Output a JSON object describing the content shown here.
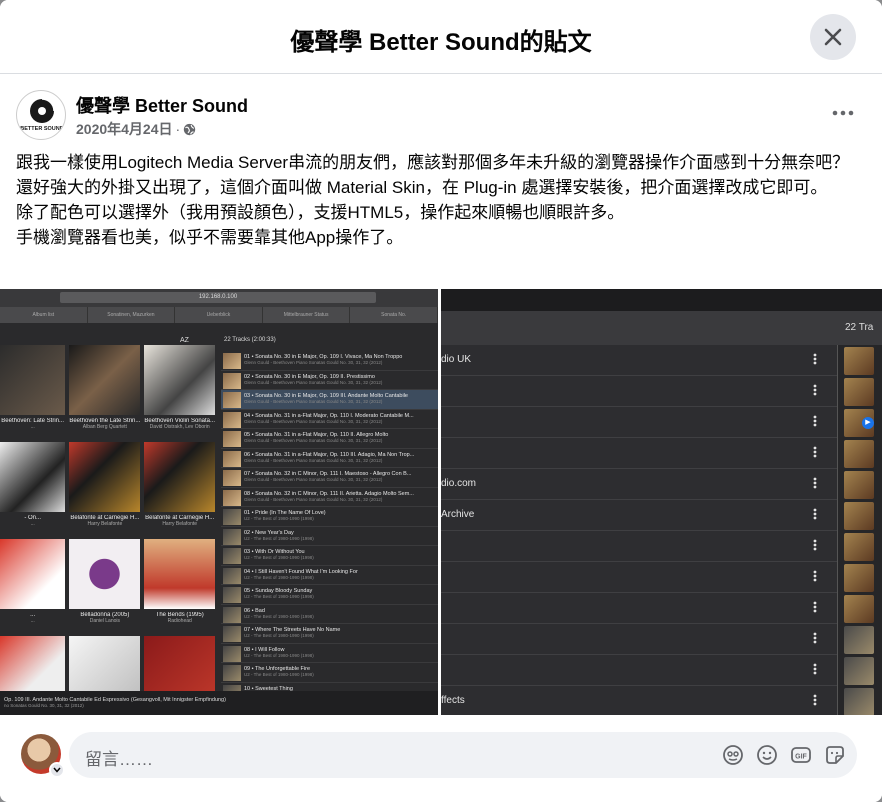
{
  "dialog": {
    "title": "優聲學 Better Sound的貼文",
    "close_label": "×"
  },
  "post": {
    "page_name": "優聲學 Better Sound",
    "logo_text": "BETTER SOUND",
    "date": "2020年4月24日",
    "date_separator": "·",
    "audience_icon": "globe-icon",
    "more_icon": "more-horizontal-icon",
    "paragraphs": [
      "跟我一樣使用Logitech Media Server串流的朋友們，應該對那個多年未升級的瀏覽器操作介面感到十分無奈吧？還好強大的外掛又出現了，這個介面叫做 Material Skin，在 Plug-in 處選擇安裝後，把介面選擇改成它即可。",
      "除了配色可以選擇外（我用預設顏色），支援HTML5，操作起來順暢也順眼許多。",
      "手機瀏覽器看也美，似乎不需要靠其他App操作了。"
    ]
  },
  "photo_left": {
    "url_text": "192.168.0.100",
    "tabs": [
      "Album list",
      "Sonatinen, Mazurken",
      "Ueberblick",
      "Mittelbrauner Status",
      "Sonata No."
    ],
    "toolbar": "AZ",
    "tracks_header": "22 Tracks (2:00:33)",
    "albums": [
      {
        "title": "Beethoven: Late Strin...",
        "sub": "..."
      },
      {
        "title": "Beethoven the Late Strin...",
        "sub": "Alban Berg Quartett"
      },
      {
        "title": "Beethoven Violin Sonata...",
        "sub": "David Oistrakh, Lev Oborin"
      },
      {
        "title": "- On...",
        "sub": "..."
      },
      {
        "title": "Belafonte at Carnegie H...",
        "sub": "Harry Belafonte"
      },
      {
        "title": "Belafonte at Carnegie H...",
        "sub": "Harry Belafonte"
      },
      {
        "title": "...",
        "sub": "..."
      },
      {
        "title": "Belladonna (2005)",
        "sub": "Daniel Lanois"
      },
      {
        "title": "The Bends (1995)",
        "sub": "Radiohead"
      },
      {
        "title": "...",
        "sub": ""
      },
      {
        "title": "",
        "sub": ""
      },
      {
        "title": "",
        "sub": ""
      }
    ],
    "tracks": [
      {
        "title": "01 • Sonata No. 30 in E Major, Op. 109 I. Vivace, Ma Non Troppo",
        "sub": "Glenn Gould - Beethoven Piano Sonatas Gould No. 30, 31, 32 (2012)"
      },
      {
        "title": "02 • Sonata No. 30 in E Major, Op. 109 II. Prestissimo",
        "sub": "Glenn Gould - Beethoven Piano Sonatas Gould No. 30, 31, 32 (2012)"
      },
      {
        "title": "03 • Sonata No. 30 in E Major, Op. 109 III. Andante Molto Cantabile",
        "sub": "Glenn Gould - Beethoven Piano Sonatas Gould No. 30, 31, 32 (2012)"
      },
      {
        "title": "04 • Sonata No. 31 in a-Flat Major, Op. 110 I. Moderato Cantabile M...",
        "sub": "Glenn Gould - Beethoven Piano Sonatas Gould No. 30, 31, 32 (2012)"
      },
      {
        "title": "05 • Sonata No. 31 in a-Flat Major, Op. 110 II. Allegro Molto",
        "sub": "Glenn Gould - Beethoven Piano Sonatas Gould No. 30, 31, 32 (2012)"
      },
      {
        "title": "06 • Sonata No. 31 in a-Flat Major, Op. 110 III. Adagio, Ma Non Trop...",
        "sub": "Glenn Gould - Beethoven Piano Sonatas Gould No. 30, 31, 32 (2012)"
      },
      {
        "title": "07 • Sonata No. 32 in C Minor, Op. 111 I. Maestoso - Allegro Con B...",
        "sub": "Glenn Gould - Beethoven Piano Sonatas Gould No. 30, 31, 32 (2012)"
      },
      {
        "title": "08 • Sonata No. 32 in C Minor, Op. 111 II. Arietta. Adagio Molto Sem...",
        "sub": "Glenn Gould - Beethoven Piano Sonatas Gould No. 30, 31, 32 (2012)"
      },
      {
        "title": "01 • Pride (In The Name Of Love)",
        "sub": "U2 - The Best of 1980-1990 (1998)"
      },
      {
        "title": "02 • New Year's Day",
        "sub": "U2 - The Best of 1980-1990 (1998)"
      },
      {
        "title": "03 • With Or Without You",
        "sub": "U2 - The Best of 1980-1990 (1998)"
      },
      {
        "title": "04 • I Still Haven't Found What I'm Looking For",
        "sub": "U2 - The Best of 1980-1990 (1998)"
      },
      {
        "title": "05 • Sunday Bloody Sunday",
        "sub": "U2 - The Best of 1980-1990 (1998)"
      },
      {
        "title": "06 • Bad",
        "sub": "U2 - The Best of 1980-1990 (1998)"
      },
      {
        "title": "07 • Where The Streets Have No Name",
        "sub": "U2 - The Best of 1980-1990 (1998)"
      },
      {
        "title": "08 • I Will Follow",
        "sub": "U2 - The Best of 1980-1990 (1998)"
      },
      {
        "title": "09 • The Unforgettable Fire",
        "sub": "U2 - The Best of 1980-1990 (1998)"
      },
      {
        "title": "10 • Sweetest Thing",
        "sub": "U2 - The Best of 1980-1990 (1998)"
      }
    ],
    "now_playing": "Op. 109 III. Andante Molto Cantabile Ed Espressivo (Gesangvoll, Mit Innigster Empfindung)",
    "now_playing_sub": "no Sonatas Gould No. 30, 31, 32 (2012)"
  },
  "photo_right": {
    "tracks_label": "22 Tra",
    "rows": [
      "dio UK",
      "",
      "",
      "",
      "dio.com",
      "Archive",
      "",
      "",
      "",
      "",
      "",
      "ffects",
      "",
      ""
    ]
  },
  "comment": {
    "placeholder": "留言……",
    "icons": [
      "sticker-face-icon",
      "emoji-icon",
      "gif-icon",
      "sticker-icon"
    ]
  }
}
